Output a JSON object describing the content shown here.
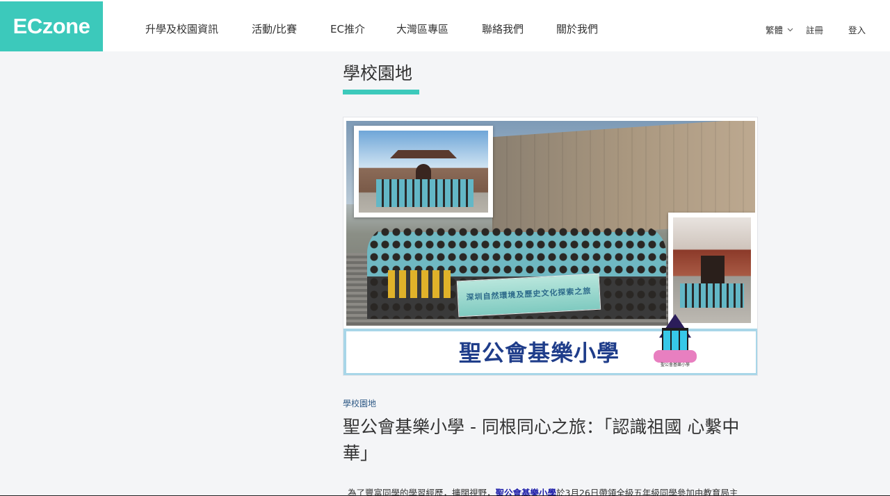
{
  "header": {
    "logo": "ECzone",
    "nav": [
      {
        "label": "升學及校園資訊"
      },
      {
        "label": "活動/比賽"
      },
      {
        "label": "EC推介"
      },
      {
        "label": "大灣區專區"
      },
      {
        "label": "聯絡我們"
      },
      {
        "label": "關於我們"
      }
    ],
    "language": "繁體",
    "register": "註冊",
    "login": "登入"
  },
  "section": {
    "title": "學校園地"
  },
  "banner": {
    "cloth_text": "深圳自然環境及歷史文化探索之旅",
    "school_name": "聖公會基樂小學",
    "logo_caption": "聖公會基樂小學"
  },
  "article": {
    "category": "學校園地",
    "headline": "聖公會基樂小學 - 同根同心之旅：「認識祖國 心繫中華」",
    "body_prefix": "為了豐富同學的學習經歷，擴闊視野，",
    "body_link": "聖公會基樂小學",
    "body_suffix": "於3月26日帶領全級五年級同學參加由教育局主"
  },
  "colors": {
    "accent": "#3cc9bb",
    "page_bg": "#f4f5f7",
    "school_name": "#1f3d8a",
    "link": "#1a1aa8"
  }
}
